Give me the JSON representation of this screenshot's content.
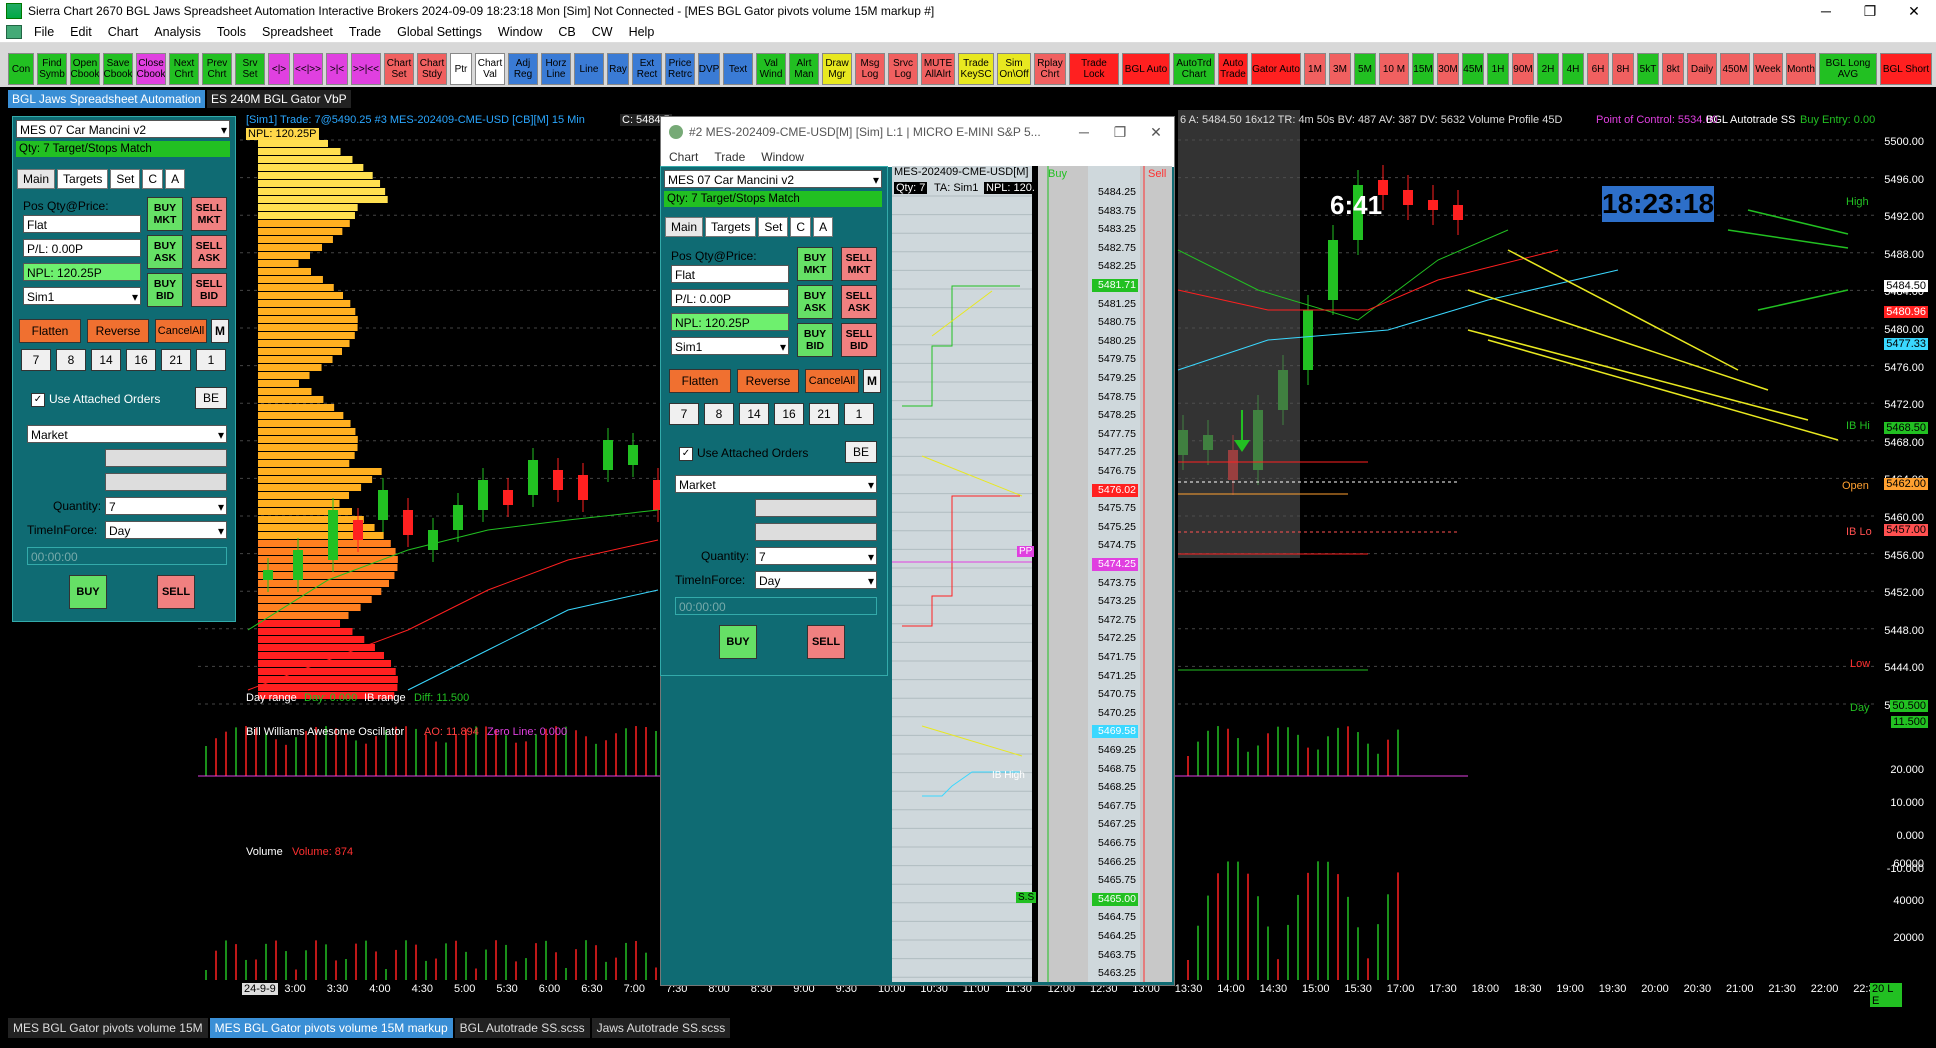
{
  "window": {
    "title": "Sierra Chart 2670 BGL Jaws Spreadsheet Automation Interactive Brokers 2024-09-09  18:23:18 Mon [Sim]  Not Connected - [MES BGL Gator pivots volume 15M markup #]",
    "minimize": "─",
    "restore": "❐",
    "close": "✕"
  },
  "menu": [
    "File",
    "Edit",
    "Chart",
    "Analysis",
    "Tools",
    "Spreadsheet",
    "Trade",
    "Global Settings",
    "Window",
    "CB",
    "CW",
    "Help"
  ],
  "toolbar": [
    {
      "label": "Con",
      "bg": "#22c022"
    },
    {
      "label": "Find Symb",
      "bg": "#22c022"
    },
    {
      "label": "Open Cbook",
      "bg": "#22c022"
    },
    {
      "label": "Save Cbook",
      "bg": "#22c022"
    },
    {
      "label": "Close Cbook",
      "bg": "#e040e0"
    },
    {
      "label": "Next Chrt",
      "bg": "#22c022"
    },
    {
      "label": "Prev Chrt",
      "bg": "#22c022"
    },
    {
      "label": "Srv Set",
      "bg": "#22c022"
    },
    {
      "label": "<|>",
      "bg": "#e040e0"
    },
    {
      "label": "<<|>>",
      "bg": "#e040e0"
    },
    {
      "label": ">|<",
      "bg": "#e040e0"
    },
    {
      "label": ">>|<<",
      "bg": "#e040e0"
    },
    {
      "label": "Chart Set",
      "bg": "#f06060"
    },
    {
      "label": "Chart Stdy",
      "bg": "#f06060"
    },
    {
      "label": "Ptr",
      "bg": "#ffffff"
    },
    {
      "label": "Chart Val",
      "bg": "#ffffff"
    },
    {
      "label": "Adj Reg",
      "bg": "#3a7bd5"
    },
    {
      "label": "Horz Line",
      "bg": "#3a7bd5"
    },
    {
      "label": "Line",
      "bg": "#3a7bd5"
    },
    {
      "label": "Ray",
      "bg": "#3a7bd5"
    },
    {
      "label": "Ext Rect",
      "bg": "#3a7bd5"
    },
    {
      "label": "Price Retrc",
      "bg": "#3a7bd5"
    },
    {
      "label": "DVP",
      "bg": "#3a7bd5"
    },
    {
      "label": "Text",
      "bg": "#3a7bd5"
    },
    {
      "label": "Val Wind",
      "bg": "#22c022"
    },
    {
      "label": "Alrt Man",
      "bg": "#22c022"
    },
    {
      "label": "Draw Mgr",
      "bg": "#e8e820"
    },
    {
      "label": "Msg Log",
      "bg": "#f06060"
    },
    {
      "label": "Srvc Log",
      "bg": "#f06060"
    },
    {
      "label": "MUTE AllAlrt",
      "bg": "#f06060"
    },
    {
      "label": "Trade KeySC",
      "bg": "#e8e820"
    },
    {
      "label": "Sim On\\Off",
      "bg": "#e8e820"
    },
    {
      "label": "Rplay Chrt",
      "bg": "#f06060"
    },
    {
      "label": "Trade Lock",
      "bg": "#ff2020"
    },
    {
      "label": "BGL Auto",
      "bg": "#ff2020"
    },
    {
      "label": "AutoTrd Chart",
      "bg": "#22c022"
    },
    {
      "label": "Auto Trade",
      "bg": "#ff2020"
    },
    {
      "label": "Gator Auto",
      "bg": "#ff2020"
    },
    {
      "label": "1M",
      "bg": "#f06060"
    },
    {
      "label": "3M",
      "bg": "#f06060"
    },
    {
      "label": "5M",
      "bg": "#22c022"
    },
    {
      "label": "10 M",
      "bg": "#f06060"
    },
    {
      "label": "15M",
      "bg": "#22c022"
    },
    {
      "label": "30M",
      "bg": "#f06060"
    },
    {
      "label": "45M",
      "bg": "#22c022"
    },
    {
      "label": "1H",
      "bg": "#22c022"
    },
    {
      "label": "90M",
      "bg": "#f06060"
    },
    {
      "label": "2H",
      "bg": "#22c022"
    },
    {
      "label": "4H",
      "bg": "#22c022"
    },
    {
      "label": "6H",
      "bg": "#f06060"
    },
    {
      "label": "8H",
      "bg": "#f06060"
    },
    {
      "label": "5kT",
      "bg": "#22c022"
    },
    {
      "label": "8kt",
      "bg": "#f06060"
    },
    {
      "label": "Daily",
      "bg": "#f06060"
    },
    {
      "label": "450M",
      "bg": "#f06060"
    },
    {
      "label": "Week",
      "bg": "#f06060"
    },
    {
      "label": "Month",
      "bg": "#f06060"
    },
    {
      "label": "BGL Long AVG",
      "bg": "#22c022"
    },
    {
      "label": "BGL Short",
      "bg": "#ff2020"
    }
  ],
  "tabs": [
    {
      "label": "BGL Jaws Spreadsheet Automation",
      "active": true
    },
    {
      "label": "ES 240M BGL Gator VbP",
      "active": false
    }
  ],
  "chart": {
    "header": "[Sim1]  Trade: 7@5490.25  #3 MES-202409-CME-USD [CB][M]  15 Min",
    "header_price": "C: 5484.5",
    "npl_header": "NPL: 120.25P",
    "right_header": "6  A: 5484.50  16x12  TR: 4m 50s  BV: 487  AV: 387  DV: 5632  Volume Profile 45D",
    "poc": "Point of Control: 5534.00",
    "autotrade": "BGL Autotrade SS",
    "buy_entry": "Buy Entry: 0.00",
    "countdown": "6:41",
    "clock": "18:23:18",
    "day_range": "Day range",
    "day_val": "Day: 0.000",
    "ib_range": "IB range",
    "ib_diff": "Diff: 11.500",
    "ao_label": "Bill Williams Awesome Oscillator",
    "ao_val": "AO: 11.894",
    "ao_zero": "Zero Line: 0.000",
    "vol_label": "Volume",
    "vol_val": "Volume: 874",
    "right_labels": {
      "high": "High",
      "ibhi": "IB Hi",
      "open": "Open",
      "iblo": "IB Lo",
      "low": "Low",
      "day": "Day"
    },
    "y_labels": [
      "5500.00",
      "5496.00",
      "5492.00",
      "5488.00",
      "5484.00",
      "5480.00",
      "5476.00",
      "5472.00",
      "5468.00",
      "5464.00",
      "5460.00",
      "5456.00",
      "5452.00",
      "5448.00",
      "5444.00",
      "5440.00"
    ],
    "y_badges": {
      "last": "5484.50",
      "red": "5480.96",
      "cyan": "5477.33",
      "ibhi": "5468.50",
      "open": "5462.00",
      "iblo": "5457.00",
      "day1": "50.500",
      "day2": "11.500"
    },
    "ao_axis": [
      "20.000",
      "10.000",
      "0.000",
      "-10.000"
    ],
    "vol_axis": [
      "60000",
      "40000",
      "20000"
    ],
    "x_labels": [
      "24-9-9",
      "3:00",
      "3:30",
      "4:00",
      "4:30",
      "5:00",
      "5:30",
      "6:00",
      "6:30",
      "7:00",
      "7:30",
      "8:00",
      "8:30",
      "9:00",
      "9:30",
      "10:00",
      "10:30",
      "11:00",
      "11:30",
      "12:00",
      "12:30",
      "13:00",
      "13:30",
      "14:00",
      "14:30",
      "15:00",
      "15:30",
      "17:00",
      "17:30",
      "18:00",
      "18:30",
      "19:00",
      "19:30",
      "20:00",
      "20:30",
      "21:00",
      "21:30",
      "22:00",
      "22:30"
    ],
    "x_end": "20 L E"
  },
  "panel": {
    "combo": "MES 07 Car Mancini v2",
    "qty_match": "Qty: 7  Target/Stops Match",
    "tabs": [
      "Main",
      "Targets",
      "Set",
      "C",
      "A"
    ],
    "pos_label": "Pos Qty@Price:",
    "pos": "Flat",
    "pl": "P/L: 0.00P",
    "npl": "NPL: 120.25P",
    "account": "Sim1",
    "buy_mkt": "BUY MKT",
    "sell_mkt": "SELL MKT",
    "buy_ask": "BUY ASK",
    "sell_ask": "SELL ASK",
    "buy_bid": "BUY BID",
    "sell_bid": "SELL BID",
    "flatten": "Flatten",
    "reverse": "Reverse",
    "cancel_all": "CancelAll",
    "m": "M",
    "qty_buttons": [
      "7",
      "8",
      "14",
      "16",
      "21",
      "1"
    ],
    "attached": "Use Attached Orders",
    "be": "BE",
    "order_type": "Market",
    "qty_label": "Quantity:",
    "qty": "7",
    "tif_label": "TimeInForce:",
    "tif": "Day",
    "time": "00:00:00",
    "buy": "BUY",
    "sell": "SELL"
  },
  "dom": {
    "title": "#2  MES-202409-CME-USD[M] [Sim]  L:1 | MICRO E-MINI S&P 5...",
    "menu": [
      "Chart",
      "Trade",
      "Window"
    ],
    "symbol": "MES-202409-CME-USD[M]",
    "qty": "Qty: 7",
    "ta": "TA: Sim1",
    "npl": "NPL: 120.",
    "buy_col": "Buy",
    "sell_col": "Sell",
    "prices": [
      "5484.25",
      "5483.75",
      "5483.25",
      "5482.75",
      "5482.25",
      "5481.71",
      "5481.25",
      "5480.75",
      "5480.25",
      "5479.75",
      "5479.25",
      "5478.75",
      "5478.25",
      "5477.75",
      "5477.25",
      "5476.75",
      "5476.02",
      "5475.75",
      "5475.25",
      "5474.75",
      "5474.25",
      "5473.75",
      "5473.25",
      "5472.75",
      "5472.25",
      "5471.75",
      "5471.25",
      "5470.75",
      "5470.25",
      "5469.58",
      "5469.25",
      "5468.75",
      "5468.25",
      "5467.75",
      "5467.25",
      "5466.75",
      "5466.25",
      "5465.75",
      "5465.00",
      "5464.75",
      "5464.25",
      "5463.75",
      "5463.25"
    ],
    "pp": "PP",
    "ib_high": "IB High",
    "ss": "S.S"
  },
  "bottom_tabs": [
    {
      "label": "MES BGL Gator pivots volume 15M",
      "active": false
    },
    {
      "label": "MES BGL Gator pivots volume 15M markup",
      "active": true
    },
    {
      "label": "BGL Autotrade SS.scss",
      "active": false
    },
    {
      "label": "Jaws Autotrade SS.scss",
      "active": false
    }
  ]
}
